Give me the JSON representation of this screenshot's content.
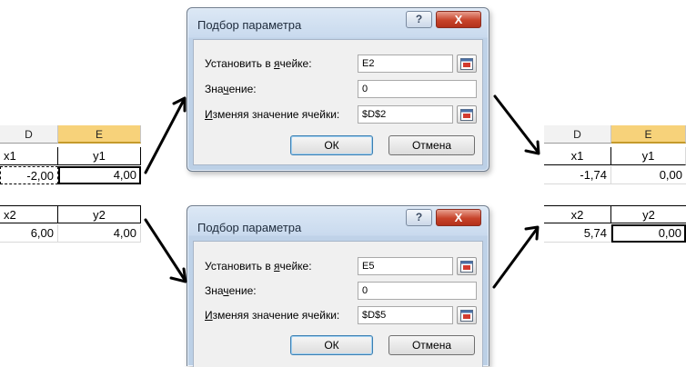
{
  "left_sheet": {
    "col_d": "D",
    "col_e": "E",
    "x1_label": "x1",
    "y1_label": "y1",
    "x1_value": "-2,00",
    "y1_value": "4,00",
    "x2_label": "x2",
    "y2_label": "y2",
    "x2_value": "6,00",
    "y2_value": "4,00"
  },
  "right_sheet": {
    "col_d": "D",
    "col_e": "E",
    "x1_label": "x1",
    "y1_label": "y1",
    "x1_value": "-1,74",
    "y1_value": "0,00",
    "x2_label": "x2",
    "y2_label": "y2",
    "x2_value": "5,74",
    "y2_value": "0,00"
  },
  "dialog_top": {
    "title": "Подбор параметра",
    "help_symbol": "?",
    "close_symbol": "X",
    "set_cell_pre": "Установить в ",
    "set_cell_u": "я",
    "set_cell_post": "чейке:",
    "set_cell_value": "E2",
    "value_pre": "Зна",
    "value_u": "ч",
    "value_post": "ение:",
    "value_value": "0",
    "change_u": "И",
    "change_post": "зменяя значение ячейки:",
    "change_value": "$D$2",
    "ok_label": "ОК",
    "cancel_label": "Отмена"
  },
  "dialog_bottom": {
    "title": "Подбор параметра",
    "help_symbol": "?",
    "close_symbol": "X",
    "set_cell_pre": "Установить в ",
    "set_cell_u": "я",
    "set_cell_post": "чейке:",
    "set_cell_value": "E5",
    "value_pre": "Зна",
    "value_u": "ч",
    "value_post": "ение:",
    "value_value": "0",
    "change_u": "И",
    "change_post": "зменяя значение ячейки:",
    "change_value": "$D$5",
    "ok_label": "ОК",
    "cancel_label": "Отмена"
  },
  "colors": {
    "selected_column_header": "#f7d27a",
    "close_button": "#c7432a",
    "dialog_frame": "#c9daee"
  },
  "icons": [
    "help-icon",
    "close-icon",
    "cell-reference-icon",
    "arrow-icon"
  ]
}
